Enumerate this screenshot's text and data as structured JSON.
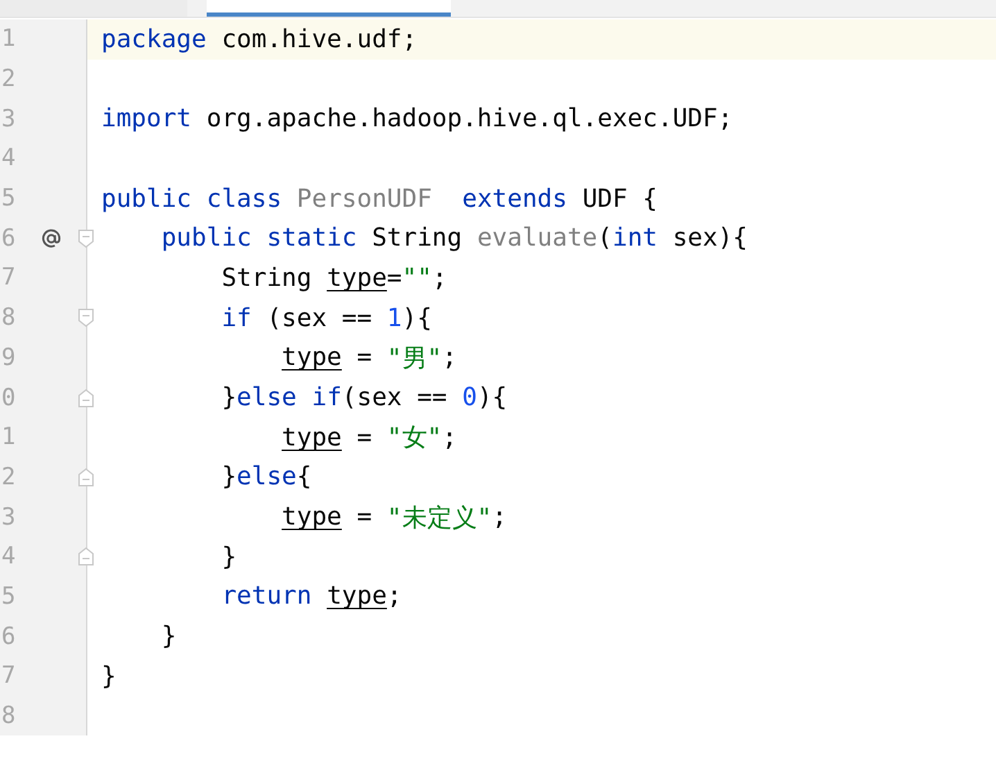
{
  "tabs": [
    {
      "selected": false
    },
    {
      "selected": true
    }
  ],
  "lines": [
    {
      "number": "1",
      "current": true,
      "kind": "plain",
      "tokens": [
        {
          "kind": "kw",
          "text": "package"
        },
        {
          "kind": "plain",
          "text": " com.hive.udf;"
        }
      ]
    },
    {
      "number": "2",
      "current": false,
      "kind": "plain"
    },
    {
      "number": "3",
      "current": false,
      "kind": "plain",
      "tokens": [
        {
          "kind": "kw",
          "text": "import"
        },
        {
          "kind": "plain",
          "text": " org.apache.hadoop.hive.ql.exec.UDF;"
        }
      ]
    },
    {
      "number": "4",
      "current": false,
      "kind": "plain"
    },
    {
      "number": "5",
      "current": false,
      "kind": "plain",
      "tokens": [
        {
          "kind": "kw",
          "text": "public class "
        },
        {
          "kind": "unused",
          "text": "PersonUDF"
        },
        {
          "kind": "kw",
          "text": "  extends"
        },
        {
          "kind": "plain",
          "text": " UDF {"
        }
      ]
    },
    {
      "number": "6",
      "current": false,
      "kind": "override",
      "tokens": [
        {
          "kind": "kw",
          "text": "    public static"
        },
        {
          "kind": "plain",
          "text": " String "
        },
        {
          "kind": "unused",
          "text": "evaluate"
        },
        {
          "kind": "plain",
          "text": "("
        },
        {
          "kind": "kw",
          "text": "int"
        },
        {
          "kind": "plain",
          "text": " sex){"
        }
      ]
    },
    {
      "number": "7",
      "current": false,
      "kind": "plain",
      "tokens": [
        {
          "kind": "plain",
          "text": "        String "
        },
        {
          "kind": "var",
          "text": "type"
        },
        {
          "kind": "plain",
          "text": "="
        },
        {
          "kind": "str",
          "text": "\"\""
        },
        {
          "kind": "plain",
          "text": ";"
        }
      ]
    },
    {
      "number": "8",
      "current": false,
      "kind": "fold-start",
      "tokens": [
        {
          "kind": "kw",
          "text": "        if"
        },
        {
          "kind": "plain",
          "text": " (sex == "
        },
        {
          "kind": "num",
          "text": "1"
        },
        {
          "kind": "plain",
          "text": "){"
        }
      ]
    },
    {
      "number": "9",
      "current": false,
      "kind": "plain",
      "tokens": [
        {
          "kind": "var",
          "text": "            type"
        },
        {
          "kind": "plain",
          "text": " = "
        },
        {
          "kind": "str",
          "text": "\"男\""
        },
        {
          "kind": "plain",
          "text": ";"
        }
      ]
    },
    {
      "number": "0",
      "current": false,
      "kind": "fold-end",
      "tokens": [
        {
          "kind": "plain",
          "text": "        }"
        },
        {
          "kind": "kw",
          "text": "else if"
        },
        {
          "kind": "plain",
          "text": "(sex == "
        },
        {
          "kind": "num",
          "text": "0"
        },
        {
          "kind": "plain",
          "text": "){"
        }
      ]
    },
    {
      "number": "1",
      "current": false,
      "kind": "plain",
      "tokens": [
        {
          "kind": "var",
          "text": "            type"
        },
        {
          "kind": "plain",
          "text": " = "
        },
        {
          "kind": "str",
          "text": "\"女\""
        },
        {
          "kind": "plain",
          "text": ";"
        }
      ]
    },
    {
      "number": "2",
      "current": false,
      "kind": "fold-end",
      "tokens": [
        {
          "kind": "plain",
          "text": "        }"
        },
        {
          "kind": "kw",
          "text": "else"
        },
        {
          "kind": "plain",
          "text": "{"
        }
      ]
    },
    {
      "number": "3",
      "current": false,
      "kind": "plain",
      "tokens": [
        {
          "kind": "var",
          "text": "            type"
        },
        {
          "kind": "plain",
          "text": " = "
        },
        {
          "kind": "str",
          "text": "\"未定义\""
        },
        {
          "kind": "plain",
          "text": ";"
        }
      ]
    },
    {
      "number": "4",
      "current": false,
      "kind": "fold-end",
      "tokens": [
        {
          "kind": "plain",
          "text": "        }"
        }
      ]
    },
    {
      "number": "5",
      "current": false,
      "kind": "plain",
      "tokens": [
        {
          "kind": "kw",
          "text": "        return"
        },
        {
          "kind": "var",
          "text": " type"
        },
        {
          "kind": "plain",
          "text": ";"
        }
      ]
    },
    {
      "number": "6",
      "current": false,
      "kind": "plain",
      "tokens": [
        {
          "kind": "plain",
          "text": "    }"
        }
      ]
    },
    {
      "number": "7",
      "current": false,
      "kind": "plain",
      "tokens": [
        {
          "kind": "plain",
          "text": "}"
        }
      ]
    },
    {
      "number": "8",
      "current": false,
      "kind": "plain"
    }
  ]
}
